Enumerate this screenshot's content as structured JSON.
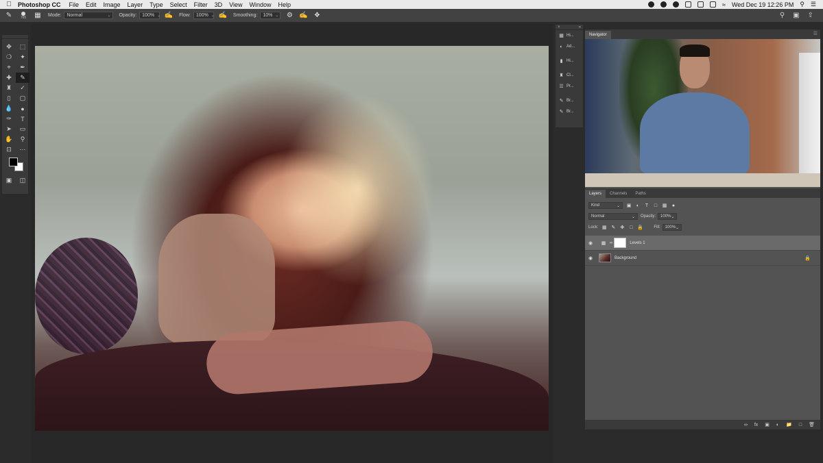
{
  "menubar": {
    "app_name": "Photoshop CC",
    "items": [
      "File",
      "Edit",
      "Image",
      "Layer",
      "Type",
      "Select",
      "Filter",
      "3D",
      "View",
      "Window",
      "Help"
    ],
    "clock": "Wed Dec 19  12:26 PM"
  },
  "options": {
    "brush_size": "765",
    "mode_label": "Mode:",
    "mode_value": "Normal",
    "opacity_label": "Opacity:",
    "opacity_value": "100%",
    "flow_label": "Flow:",
    "flow_value": "100%",
    "smoothing_label": "Smoothing:",
    "smoothing_value": "10%"
  },
  "mini_panels": {
    "items": [
      "Hi...",
      "Ad...",
      "Hi...",
      "Cl...",
      "Pr...",
      "Br...",
      "Br..."
    ]
  },
  "navigator": {
    "tab": "Navigator"
  },
  "layers_panel": {
    "tabs": [
      "Layers",
      "Channels",
      "Paths"
    ],
    "filter_kind": "Kind",
    "blend_mode": "Normal",
    "opacity_label": "Opacity:",
    "opacity_value": "100%",
    "lock_label": "Lock:",
    "fill_label": "Fill:",
    "fill_value": "100%",
    "layers": [
      {
        "name": "Levels 1"
      },
      {
        "name": "Background"
      }
    ]
  },
  "colors": {
    "foreground": "#000000",
    "background": "#ffffff"
  }
}
